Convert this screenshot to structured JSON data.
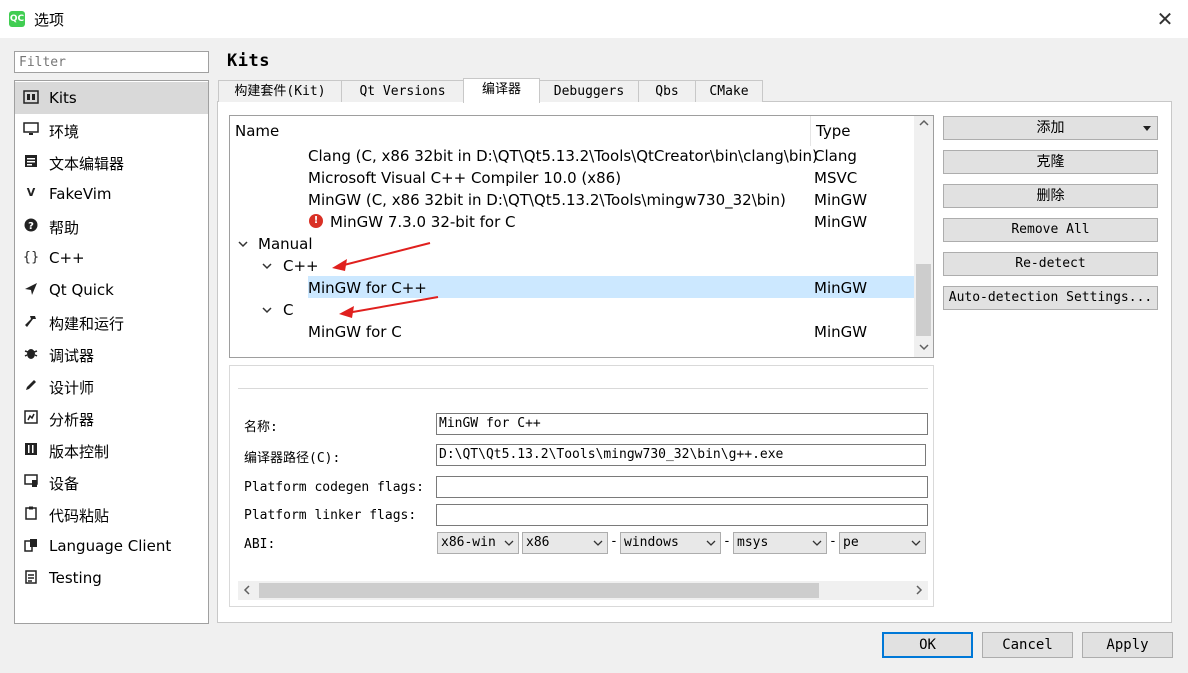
{
  "window": {
    "title": "选项",
    "app_icon": "QC",
    "close": "✕"
  },
  "filter": {
    "placeholder": "Filter"
  },
  "sidebar": {
    "items": [
      {
        "label": "Kits",
        "icon": "kits-icon",
        "selected": true
      },
      {
        "label": "环境",
        "icon": "monitor-icon"
      },
      {
        "label": "文本编辑器",
        "icon": "text-editor-icon"
      },
      {
        "label": "FakeVim",
        "icon": "fakevim-icon"
      },
      {
        "label": "帮助",
        "icon": "help-icon"
      },
      {
        "label": "C++",
        "icon": "braces-icon"
      },
      {
        "label": "Qt Quick",
        "icon": "qt-quick-icon"
      },
      {
        "label": "构建和运行",
        "icon": "hammer-icon"
      },
      {
        "label": "调试器",
        "icon": "bug-icon"
      },
      {
        "label": "设计师",
        "icon": "pencil-icon"
      },
      {
        "label": "分析器",
        "icon": "analyzer-icon"
      },
      {
        "label": "版本控制",
        "icon": "version-control-icon"
      },
      {
        "label": "设备",
        "icon": "device-icon"
      },
      {
        "label": "代码粘贴",
        "icon": "paste-icon"
      },
      {
        "label": "Language Client",
        "icon": "language-client-icon"
      },
      {
        "label": "Testing",
        "icon": "testing-icon"
      }
    ]
  },
  "page_title": "Kits",
  "tabs": [
    {
      "label": "构建套件(Kit)"
    },
    {
      "label": "Qt Versions"
    },
    {
      "label": "编译器",
      "active": true
    },
    {
      "label": "Debuggers"
    },
    {
      "label": "Qbs"
    },
    {
      "label": "CMake"
    }
  ],
  "tree": {
    "col_name": "Name",
    "col_type": "Type",
    "rows": [
      {
        "name": "Clang (C, x86 32bit in D:\\QT\\Qt5.13.2\\Tools\\QtCreator\\bin\\clang\\bin)",
        "type": "Clang"
      },
      {
        "name": "Microsoft Visual C++ Compiler 10.0 (x86)",
        "type": "MSVC"
      },
      {
        "name": "MinGW (C, x86 32bit in D:\\QT\\Qt5.13.2\\Tools\\mingw730_32\\bin)",
        "type": "MinGW"
      },
      {
        "name": "MinGW 7.3.0 32-bit for C",
        "type": "MinGW",
        "error": true
      }
    ],
    "manual_label": "Manual",
    "cpp_group": "C++",
    "cpp_item": {
      "name": "MinGW for C++",
      "type": "MinGW",
      "selected": true
    },
    "c_group": "C",
    "c_item": {
      "name": "MinGW for C",
      "type": "MinGW"
    }
  },
  "buttons": {
    "add": "添加",
    "clone": "克隆",
    "delete": "删除",
    "remove_all": "Remove All",
    "redetect": "Re-detect",
    "auto_settings": "Auto-detection Settings..."
  },
  "details": {
    "name_label": "名称:",
    "name_value": "MinGW for C++",
    "path_label": "编译器路径(C):",
    "path_value": "D:\\QT\\Qt5.13.2\\Tools\\mingw730_32\\bin\\g++.exe",
    "codegen_label": "Platform codegen flags:",
    "codegen_value": "",
    "linker_label": "Platform linker flags:",
    "linker_value": "",
    "abi_label": "ABI:",
    "abi": [
      "x86-win",
      "x86",
      "windows",
      "msys",
      "pe"
    ],
    "abi_sep": "-"
  },
  "dialog": {
    "ok": "OK",
    "cancel": "Cancel",
    "apply": "Apply"
  },
  "colors": {
    "selection": "#cce8ff",
    "arrow": "#e0201e",
    "default_border": "#0078d7"
  }
}
